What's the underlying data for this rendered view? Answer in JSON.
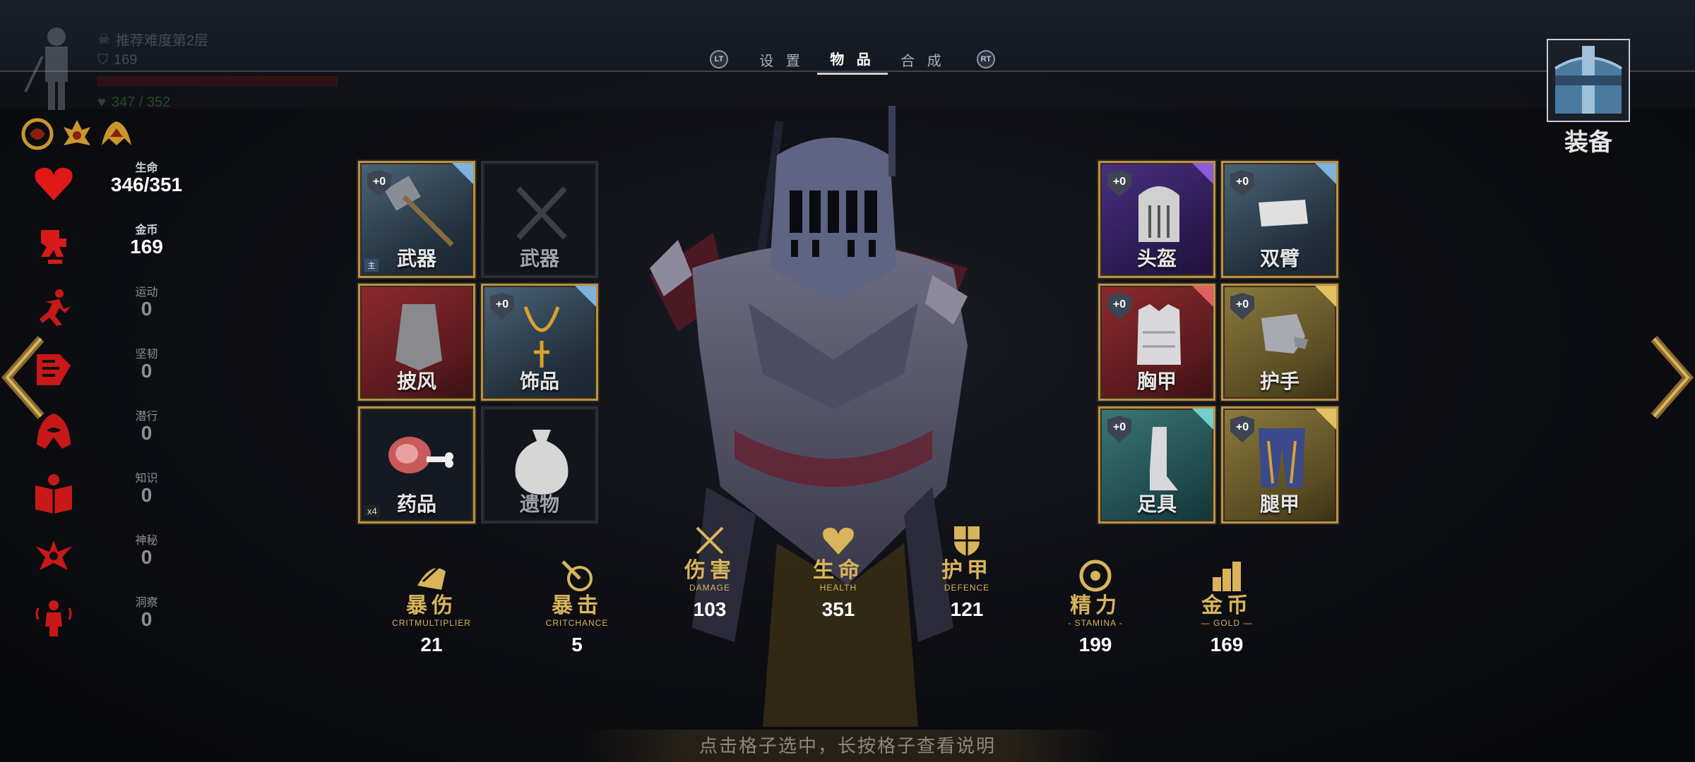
{
  "tabs": {
    "left_button": "LT",
    "right_button": "RT",
    "items": [
      "设 置",
      "物 品",
      "合 成"
    ],
    "active_index": 1
  },
  "player": {
    "difficulty": "推荐难度第2层",
    "level": "169",
    "hp": "347 / 352"
  },
  "stats": [
    {
      "label": "生命",
      "value": "346/351",
      "icon": "heart-icon"
    },
    {
      "label": "金币",
      "value": "169",
      "icon": "gold-icon"
    },
    {
      "label": "运动",
      "value": "0",
      "icon": "athletics-icon"
    },
    {
      "label": "坚韧",
      "value": "0",
      "icon": "toughness-icon"
    },
    {
      "label": "潜行",
      "value": "0",
      "icon": "stealth-icon"
    },
    {
      "label": "知识",
      "value": "0",
      "icon": "knowledge-icon"
    },
    {
      "label": "神秘",
      "value": "0",
      "icon": "mystic-icon"
    },
    {
      "label": "洞察",
      "value": "0",
      "icon": "insight-icon"
    }
  ],
  "left_slots": [
    {
      "label": "武器",
      "plus": "+0",
      "tag": "主",
      "kind": "blue"
    },
    {
      "label": "武器",
      "kind": "empty"
    },
    {
      "label": "披风",
      "kind": "red"
    },
    {
      "label": "饰品",
      "plus": "+0",
      "kind": "blue"
    },
    {
      "label": "药品",
      "count": "x4",
      "kind": "dark"
    },
    {
      "label": "遗物",
      "kind": "empty"
    }
  ],
  "right_slots": [
    {
      "label": "头盔",
      "plus": "+0",
      "kind": "purple"
    },
    {
      "label": "双臂",
      "plus": "+0",
      "kind": "blue"
    },
    {
      "label": "胸甲",
      "plus": "+0",
      "kind": "red"
    },
    {
      "label": "护手",
      "plus": "+0",
      "kind": "gold"
    },
    {
      "label": "足具",
      "plus": "+0",
      "kind": "teal"
    },
    {
      "label": "腿甲",
      "plus": "+0",
      "kind": "gold"
    }
  ],
  "summary": [
    {
      "name": "暴伤",
      "en": "CRITMULTIPLIER",
      "value": "21"
    },
    {
      "name": "暴击",
      "en": "CRITCHANCE",
      "value": "5"
    },
    {
      "name": "伤害",
      "en": "DAMAGE",
      "value": "103"
    },
    {
      "name": "生命",
      "en": "HEALTH",
      "value": "351"
    },
    {
      "name": "护甲",
      "en": "DEFENCE",
      "value": "121"
    },
    {
      "name": "精力",
      "en": "- STAMINA -",
      "value": "199"
    },
    {
      "name": "金币",
      "en": "— GOLD —",
      "value": "169"
    }
  ],
  "hint": "点击格子选中，长按格子查看说明",
  "equip_label": "装备",
  "colors": {
    "gold": "#d9b45a",
    "frame": "#b8924a",
    "red": "#e01818"
  }
}
